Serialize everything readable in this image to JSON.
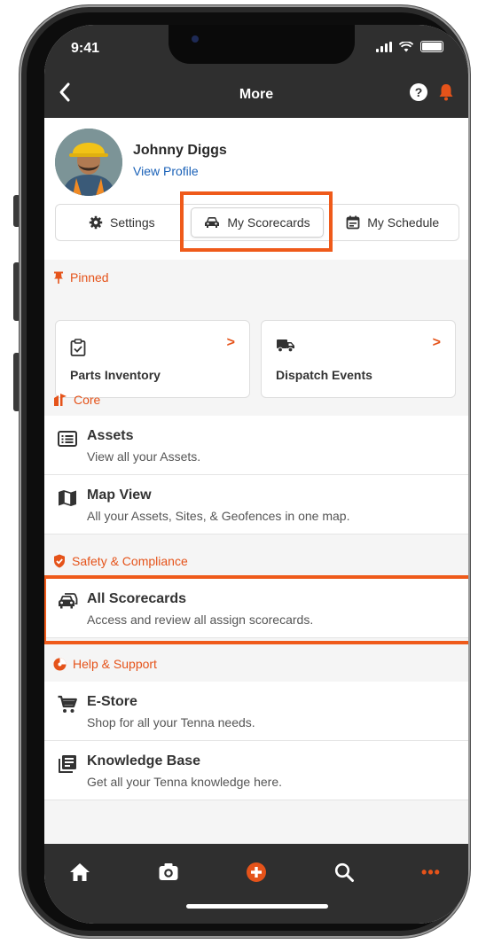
{
  "status_bar": {
    "time": "9:41"
  },
  "nav": {
    "title": "More",
    "help_glyph": "?"
  },
  "profile": {
    "name": "Johnny Diggs",
    "link": "View Profile"
  },
  "segmented": [
    {
      "label": "Settings",
      "icon": "gear-icon"
    },
    {
      "label": "My Scorecards",
      "icon": "car-icon",
      "selected": true
    },
    {
      "label": "My Schedule",
      "icon": "calendar-icon"
    }
  ],
  "sections": {
    "pinned": "Pinned",
    "core": "Core",
    "safety": "Safety & Compliance",
    "help": "Help & Support"
  },
  "pinned_cards": [
    {
      "label": "Parts Inventory",
      "icon": "clipboard-icon",
      "chevron": ">"
    },
    {
      "label": "Dispatch Events",
      "icon": "truck-icon",
      "chevron": ">"
    }
  ],
  "core_rows": [
    {
      "title": "Assets",
      "subtitle": "View all your Assets.",
      "icon": "list-icon"
    },
    {
      "title": "Map View",
      "subtitle": "All your Assets, Sites, & Geofences in one map.",
      "icon": "map-icon"
    }
  ],
  "safety_rows": [
    {
      "title": "All Scorecards",
      "subtitle": "Access and review all assign scorecards.",
      "icon": "cars-icon"
    }
  ],
  "help_rows": [
    {
      "title": "E-Store",
      "subtitle": "Shop for all your Tenna needs.",
      "icon": "cart-icon"
    },
    {
      "title": "Knowledge Base",
      "subtitle": "Get all your Tenna knowledge here.",
      "icon": "book-icon"
    }
  ],
  "tabbar": {
    "items": [
      "home-icon",
      "camera-icon",
      "add-icon",
      "search-icon",
      "more-icon"
    ],
    "more_glyph": "•••"
  },
  "colors": {
    "accent": "#E5531A",
    "bar": "#2F2F2F",
    "link": "#1B62B8",
    "highlight": "#EF5A1A"
  }
}
